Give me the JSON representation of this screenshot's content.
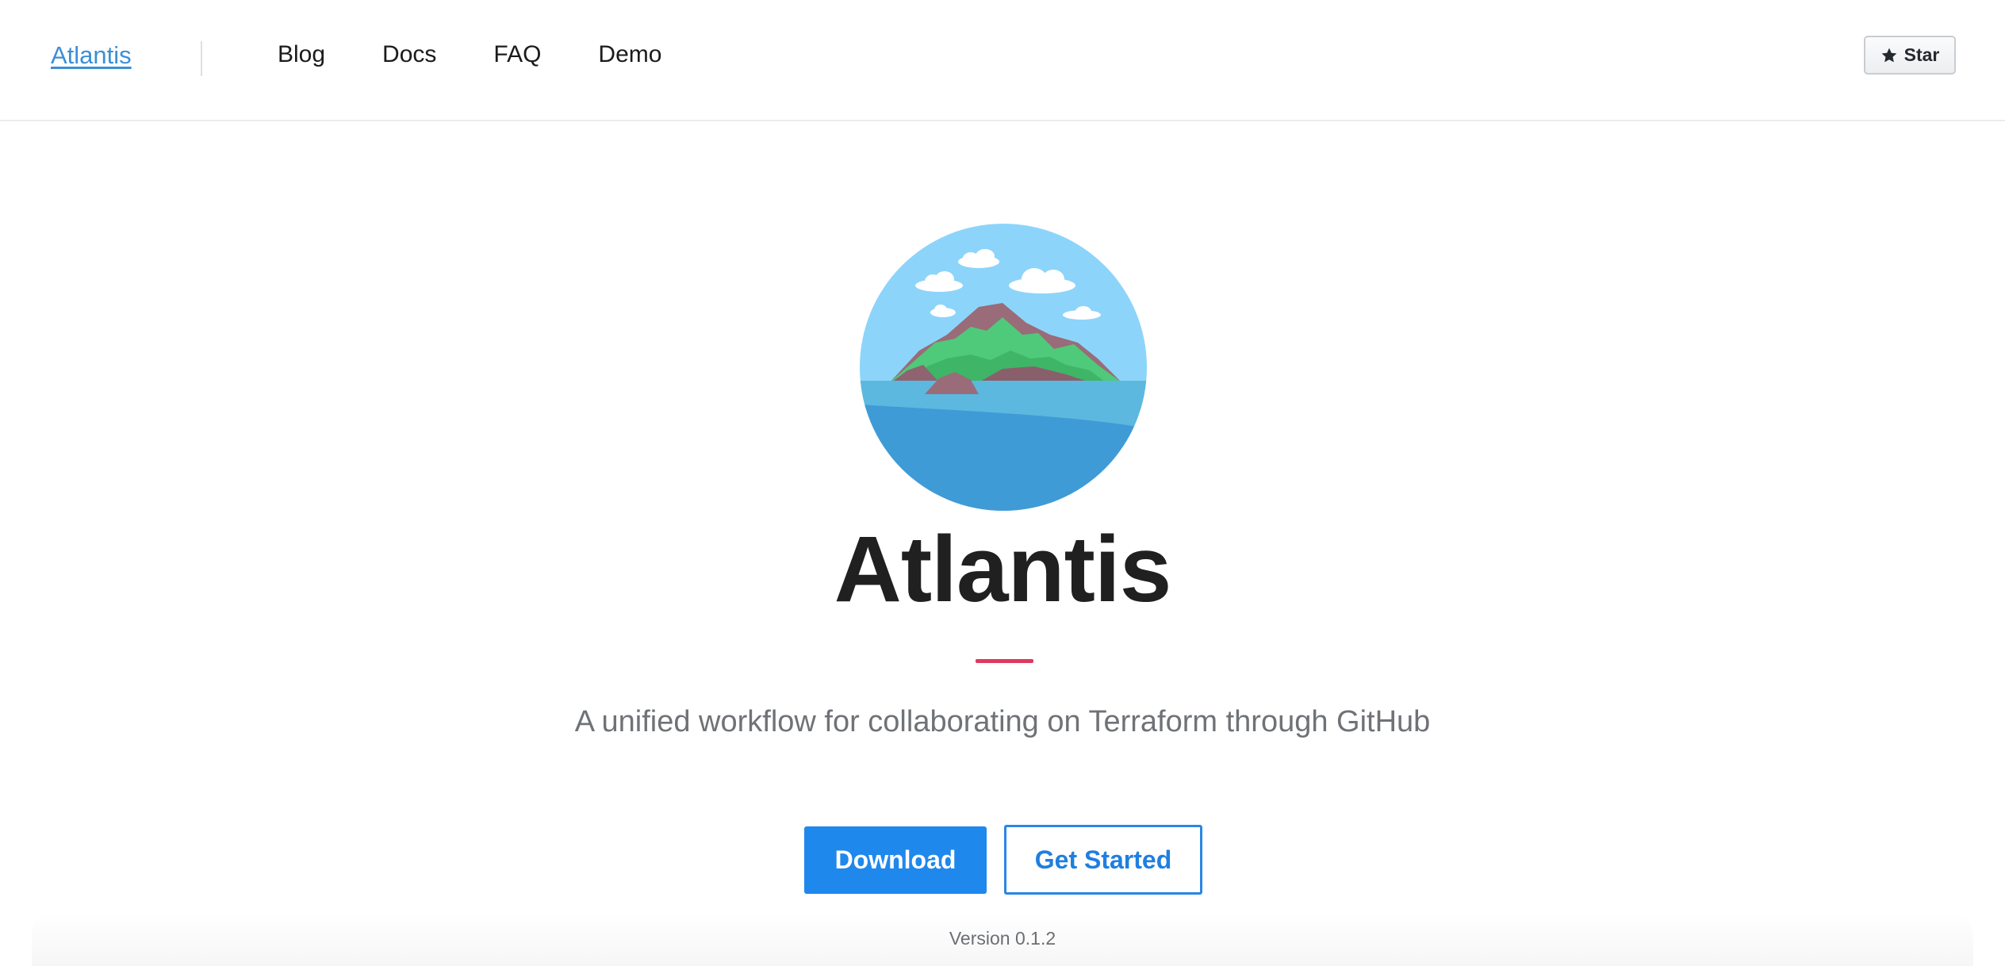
{
  "header": {
    "brand": "Atlantis",
    "nav": [
      "Blog",
      "Docs",
      "FAQ",
      "Demo"
    ],
    "star_label": "Star"
  },
  "hero": {
    "title": "Atlantis",
    "tagline": "A unified workflow for collaborating on Terraform through GitHub",
    "download_label": "Download",
    "get_started_label": "Get Started",
    "version": "Version 0.1.2"
  },
  "colors": {
    "link_blue": "#3b8fd6",
    "primary_button": "#1f88ec",
    "accent_red": "#e0395e",
    "sky": "#8dd4fb",
    "sea": "#3f9bd6"
  },
  "icons": {
    "star": "star-icon",
    "logo": "island-logo-icon"
  }
}
